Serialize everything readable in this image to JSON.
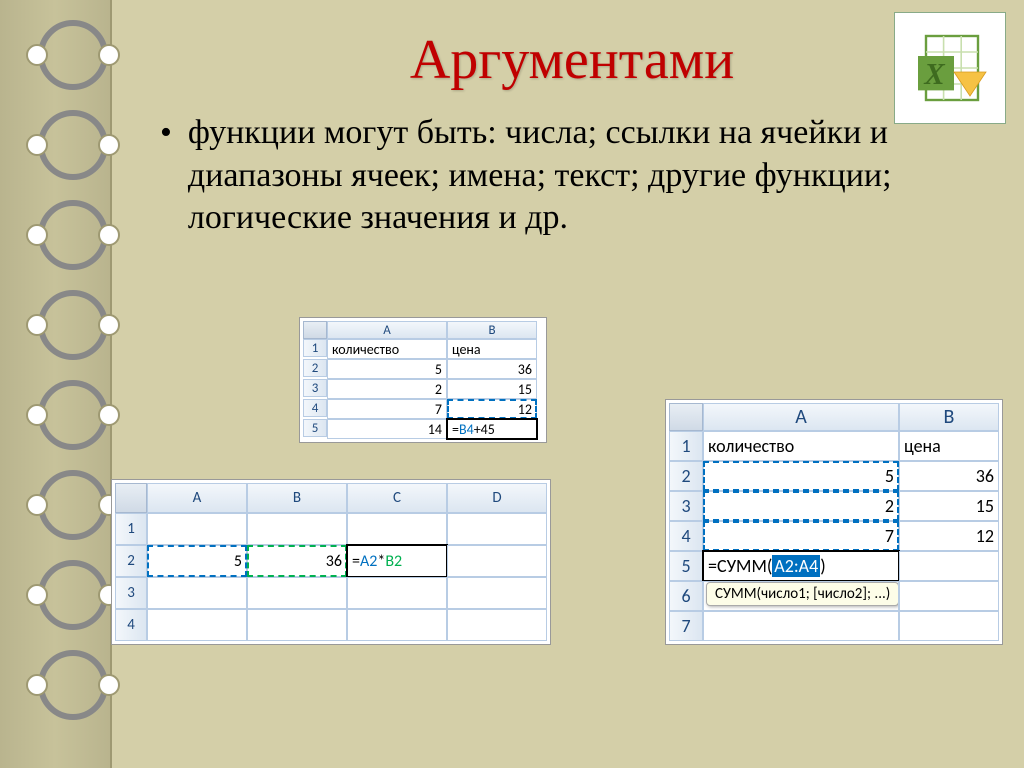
{
  "title": "Аргументами",
  "body_text": "функции могут быть: числа; ссылки на ячейки и диапазоны ячеек; имена; текст; другие функции; логические значения и др.",
  "table1": {
    "cols": [
      "A",
      "B"
    ],
    "rows": [
      "1",
      "2",
      "3",
      "4",
      "5"
    ],
    "h1": "количество",
    "h2": "цена",
    "a2": "5",
    "b2": "36",
    "a3": "2",
    "b3": "15",
    "a4": "7",
    "b4": "12",
    "a5": "14",
    "formula_plain": "=",
    "formula_ref": "B4",
    "formula_tail": "+45"
  },
  "table2": {
    "cols": [
      "A",
      "B",
      "C",
      "D"
    ],
    "rows": [
      "1",
      "2",
      "3",
      "4"
    ],
    "a2": "5",
    "b2": "36",
    "formula_plain": "=",
    "formula_a": "A2",
    "formula_mid": "*",
    "formula_b": "B2"
  },
  "table3": {
    "cols": [
      "A",
      "B"
    ],
    "rows": [
      "1",
      "2",
      "3",
      "4",
      "5",
      "6",
      "7"
    ],
    "h1": "количество",
    "h2": "цена",
    "a2": "5",
    "b2": "36",
    "a3": "2",
    "b3": "15",
    "a4": "7",
    "b4": "12",
    "formula_plain": "=СУММ(",
    "formula_range": "A2:A4",
    "formula_close": ")",
    "tooltip": "СУММ(число1; [число2]; ...)"
  }
}
